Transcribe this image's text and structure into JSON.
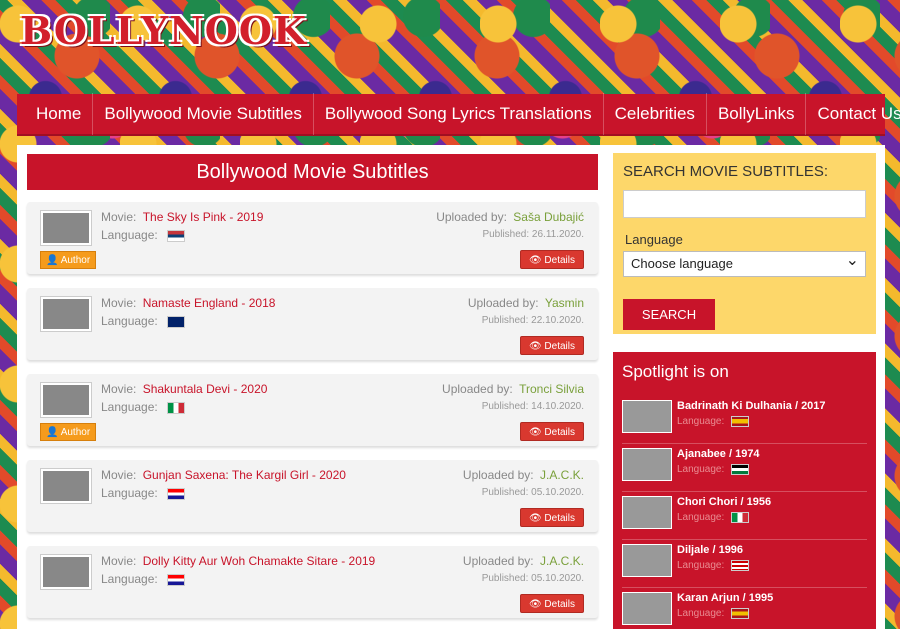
{
  "site": {
    "logo": "BOLLYNOOK"
  },
  "nav": [
    "Home",
    "Bollywood Movie Subtitles",
    "Bollywood Song Lyrics Translations",
    "Celebrities",
    "BollyLinks",
    "Contact Us"
  ],
  "main": {
    "title": "Bollywood Movie Subtitles",
    "movie_label": "Movie:",
    "language_label": "Language:",
    "uploaded_label": "Uploaded by:",
    "details_label": "Details",
    "author_label": "Author",
    "cards": [
      {
        "movie": "The Sky Is Pink - 2019",
        "uploader": "Saša Dubajić",
        "published": "Published: 26.11.2020.",
        "flag": "serbia",
        "author": true
      },
      {
        "movie": "Namaste England - 2018",
        "uploader": "Yasmin",
        "published": "Published: 22.10.2020.",
        "flag": "uk",
        "author": false
      },
      {
        "movie": "Shakuntala Devi - 2020",
        "uploader": "Tronci Silvia",
        "published": "Published: 14.10.2020.",
        "flag": "italy",
        "author": true
      },
      {
        "movie": "Gunjan Saxena: The Kargil Girl - 2020",
        "uploader": "J.A.C.K.",
        "published": "Published: 05.10.2020.",
        "flag": "croatia",
        "author": false
      },
      {
        "movie": "Dolly Kitty Aur Woh Chamakte Sitare - 2019",
        "uploader": "J.A.C.K.",
        "published": "Published: 05.10.2020.",
        "flag": "croatia",
        "author": false
      }
    ]
  },
  "sidebar": {
    "search_title": "SEARCH MOVIE SUBTITLES:",
    "language_label": "Language",
    "language_select": "Choose language",
    "search_button": "SEARCH",
    "spotlight_title": "Spotlight is on",
    "spotlight_lang_label": "Language:",
    "spotlight": [
      {
        "title": "Badrinath Ki Dulhania / 2017",
        "flag": "spain"
      },
      {
        "title": "Ajanabee / 1974",
        "flag": "jordan"
      },
      {
        "title": "Chori Chori / 1956",
        "flag": "italy"
      },
      {
        "title": "Diljale / 1996",
        "flag": "malaysia"
      },
      {
        "title": "Karan Arjun / 1995",
        "flag": "spain"
      }
    ]
  },
  "colors": {
    "accent": "#c8142a",
    "search_bg": "#fdd76a",
    "uploader": "#7aa03b",
    "author": "#f59b1c"
  }
}
